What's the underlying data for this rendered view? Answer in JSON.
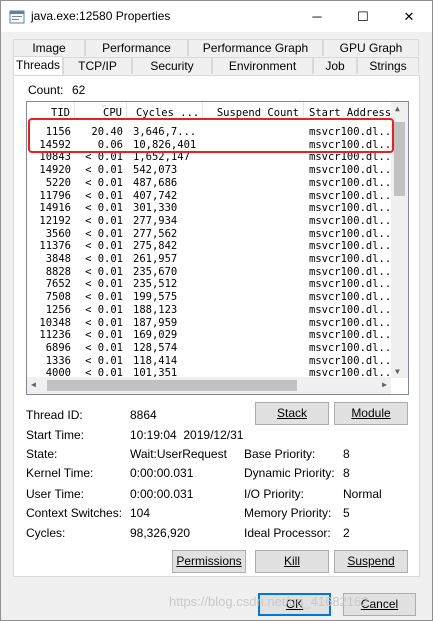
{
  "window": {
    "title": "java.exe:12580 Properties",
    "minimize": "─",
    "maximize": "☐",
    "close": "✕"
  },
  "tabs_row1": [
    "Image",
    "Performance",
    "Performance Graph",
    "GPU Graph"
  ],
  "tabs_row2": [
    "Threads",
    "TCP/IP",
    "Security",
    "Environment",
    "Job",
    "Strings"
  ],
  "active_tab": "Threads",
  "count": {
    "label": "Count:",
    "value": "62"
  },
  "list": {
    "columns": [
      "TID",
      "CPU",
      "Cycles ...",
      "Suspend Count",
      "Start Address"
    ],
    "rows": [
      [
        "1156",
        "20.40",
        "3,646,7...",
        "",
        "msvcr100.dl..."
      ],
      [
        "14592",
        "0.06",
        "10,826,401",
        "",
        "msvcr100.dl..."
      ],
      [
        "10843",
        "< 0.01",
        "1,652,147",
        "",
        "msvcr100.dl..."
      ],
      [
        "14920",
        "< 0.01",
        "542,073",
        "",
        "msvcr100.dl..."
      ],
      [
        "5220",
        "< 0.01",
        "487,686",
        "",
        "msvcr100.dl..."
      ],
      [
        "11796",
        "< 0.01",
        "407,742",
        "",
        "msvcr100.dl..."
      ],
      [
        "14916",
        "< 0.01",
        "301,330",
        "",
        "msvcr100.dl..."
      ],
      [
        "12192",
        "< 0.01",
        "277,934",
        "",
        "msvcr100.dl..."
      ],
      [
        "3560",
        "< 0.01",
        "277,562",
        "",
        "msvcr100.dl..."
      ],
      [
        "11376",
        "< 0.01",
        "275,842",
        "",
        "msvcr100.dl..."
      ],
      [
        "3848",
        "< 0.01",
        "261,957",
        "",
        "msvcr100.dl..."
      ],
      [
        "8828",
        "< 0.01",
        "235,670",
        "",
        "msvcr100.dl..."
      ],
      [
        "7652",
        "< 0.01",
        "235,512",
        "",
        "msvcr100.dl..."
      ],
      [
        "7508",
        "< 0.01",
        "199,575",
        "",
        "msvcr100.dl..."
      ],
      [
        "1256",
        "< 0.01",
        "188,123",
        "",
        "msvcr100.dl..."
      ],
      [
        "10348",
        "< 0.01",
        "187,959",
        "",
        "msvcr100.dl..."
      ],
      [
        "11236",
        "< 0.01",
        "169,029",
        "",
        "msvcr100.dl..."
      ],
      [
        "6896",
        "< 0.01",
        "128,574",
        "",
        "msvcr100.dl..."
      ],
      [
        "1336",
        "< 0.01",
        "118,414",
        "",
        "msvcr100.dl..."
      ],
      [
        "4000",
        "< 0.01",
        "101,351",
        "",
        "msvcr100.dl..."
      ]
    ]
  },
  "details": {
    "thread_id_label": "Thread ID:",
    "thread_id": "8864",
    "start_time_label": "Start Time:",
    "start_time": "10:19:04  2019/12/31",
    "state_label": "State:",
    "state": "Wait:UserRequest",
    "kernel_time_label": "Kernel Time:",
    "kernel_time": "0:00:00.031",
    "user_time_label": "User Time:",
    "user_time": "0:00:00.031",
    "context_switches_label": "Context Switches:",
    "context_switches": "104",
    "cycles_label": "Cycles:",
    "cycles": "98,326,920",
    "base_priority_label": "Base Priority:",
    "base_priority": "8",
    "dynamic_priority_label": "Dynamic Priority:",
    "dynamic_priority": "8",
    "io_priority_label": "I/O Priority:",
    "io_priority": "Normal",
    "memory_priority_label": "Memory Priority:",
    "memory_priority": "5",
    "ideal_processor_label": "Ideal Processor:",
    "ideal_processor": "2"
  },
  "buttons": {
    "stack": "Stack",
    "module": "Module",
    "permissions": "Permissions",
    "kill": "Kill",
    "suspend": "Suspend",
    "ok": "OK",
    "cancel": "Cancel"
  },
  "watermark": "https://blog.csdn.net/qq_41682162",
  "colors": {
    "highlight_box": "#e8211d",
    "accent": "#0078d7"
  }
}
